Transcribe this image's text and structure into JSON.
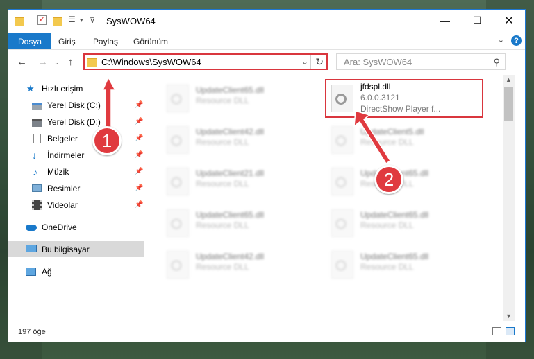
{
  "window": {
    "title": "SysWOW64"
  },
  "ribbon": {
    "tabs": [
      {
        "label": "Dosya"
      },
      {
        "label": "Giriş"
      },
      {
        "label": "Paylaş"
      },
      {
        "label": "Görünüm"
      }
    ],
    "help": "?"
  },
  "navbar": {
    "address": "C:\\Windows\\SysWOW64",
    "search_placeholder": "Ara: SysWOW64"
  },
  "sidebar": {
    "items": [
      {
        "label": "Hızlı erişim",
        "icon": "star-icon"
      },
      {
        "label": "Yerel Disk (C:)",
        "icon": "drive-icon",
        "pinned": true
      },
      {
        "label": "Yerel Disk (D:)",
        "icon": "drive-icon",
        "pinned": true
      },
      {
        "label": "Belgeler",
        "icon": "document-icon",
        "pinned": true
      },
      {
        "label": "İndirmeler",
        "icon": "download-icon",
        "pinned": true
      },
      {
        "label": "Müzik",
        "icon": "music-icon",
        "pinned": true
      },
      {
        "label": "Resimler",
        "icon": "pictures-icon",
        "pinned": true
      },
      {
        "label": "Videolar",
        "icon": "video-icon",
        "pinned": true
      },
      {
        "label": "OneDrive",
        "icon": "cloud-icon"
      },
      {
        "label": "Bu bilgisayar",
        "icon": "computer-icon",
        "selected": true
      },
      {
        "label": "Ağ",
        "icon": "network-icon"
      }
    ]
  },
  "files": {
    "highlighted": {
      "name": "jfdspl.dll",
      "version": "6.0.0.3121",
      "description": "DirectShow Player f..."
    },
    "left_column": [
      {
        "name": "UpdateClient65.dll",
        "type": "Resource DLL"
      },
      {
        "name": "UpdateClient42.dll",
        "type": "Resource DLL"
      },
      {
        "name": "UpdateClient21.dll",
        "type": "Resource DLL"
      },
      {
        "name": "UpdateClient65.dll",
        "type": "Resource DLL"
      },
      {
        "name": "UpdateClient42.dll",
        "type": "Resource DLL"
      }
    ],
    "right_column": [
      {
        "name": "UpdateClient5.dll",
        "type": "Resource DLL"
      },
      {
        "name": "UpdateClient65.dll",
        "type": "Resource DLL"
      },
      {
        "name": "UpdateClient65.dll",
        "type": "Resource DLL"
      },
      {
        "name": "UpdateClient65.dll",
        "type": "Resource DLL"
      }
    ]
  },
  "status": {
    "count": "197 öğe"
  },
  "annotations": [
    {
      "label": "1"
    },
    {
      "label": "2"
    }
  ],
  "colors": {
    "accent": "#1979ca",
    "highlight": "#d9363e",
    "badge": "#e03a3f"
  }
}
